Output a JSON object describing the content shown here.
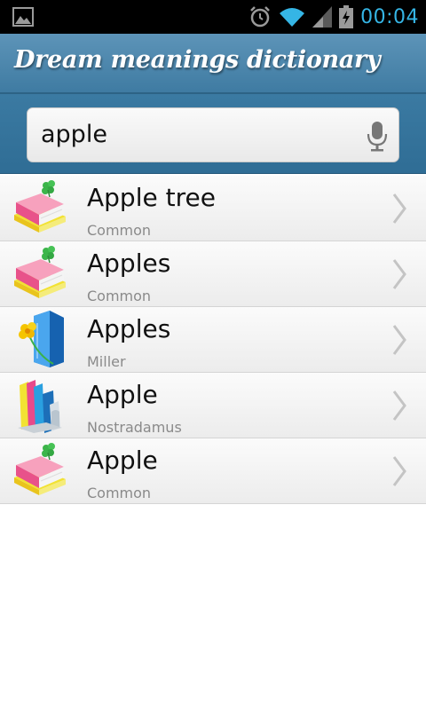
{
  "status_bar": {
    "time": "00:04",
    "icons": [
      "gallery-icon",
      "alarm-icon",
      "wifi-icon",
      "signal-icon",
      "battery-charging-icon"
    ]
  },
  "header": {
    "title": "Dream meanings dictionary"
  },
  "search": {
    "value": "apple",
    "icon": "microphone-icon"
  },
  "results": [
    {
      "title": "Apple tree",
      "source": "Common",
      "icon": "pink-book-clover-icon"
    },
    {
      "title": "Apples",
      "source": "Common",
      "icon": "pink-book-clover-icon"
    },
    {
      "title": "Apples",
      "source": "Miller",
      "icon": "blue-book-flower-icon"
    },
    {
      "title": "Apple",
      "source": "Nostradamus",
      "icon": "book-stack-icon"
    },
    {
      "title": "Apple",
      "source": "Common",
      "icon": "pink-book-clover-icon"
    }
  ],
  "colors": {
    "header": "#4a86ad",
    "clock": "#35b5e5"
  }
}
